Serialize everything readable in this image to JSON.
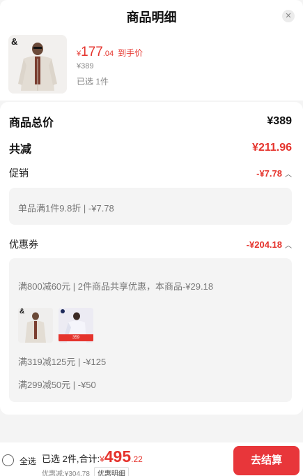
{
  "header": {
    "title": "商品明细"
  },
  "product": {
    "brand_mark": "&",
    "price_yen": "¥",
    "price_int": "177",
    "price_dec": ".04",
    "price_tag": "到手价",
    "original_price": "¥389",
    "selected": "已选 1件"
  },
  "summary": {
    "total_label": "商品总价",
    "total_value": "¥389",
    "discount_label": "共减",
    "discount_value": "¥211.96"
  },
  "promotion": {
    "label": "促销",
    "value": "-¥7.78",
    "detail": "单品满1件9.8折 | -¥7.78"
  },
  "coupon": {
    "label": "优惠券",
    "value": "-¥204.18",
    "detail_1": "满800减60元 | 2件商品共享优惠，本商品-¥29.18",
    "thumb_brand": "&",
    "thumb_badge": "359",
    "detail_2": "满319减125元 | -¥125",
    "detail_3": "满299减50元 | -¥50"
  },
  "bottom_bar": {
    "select_all": "全选",
    "selected_total_label": "已选 2件,合计:",
    "total_yen": "¥",
    "total_int": "495",
    "total_dec": ".22",
    "discount_text": "优惠减:¥304.78",
    "discount_detail_link": "优惠明细",
    "checkout_button": "去结算"
  },
  "colors": {
    "accent": "#e5332c",
    "button": "#e8363a"
  }
}
